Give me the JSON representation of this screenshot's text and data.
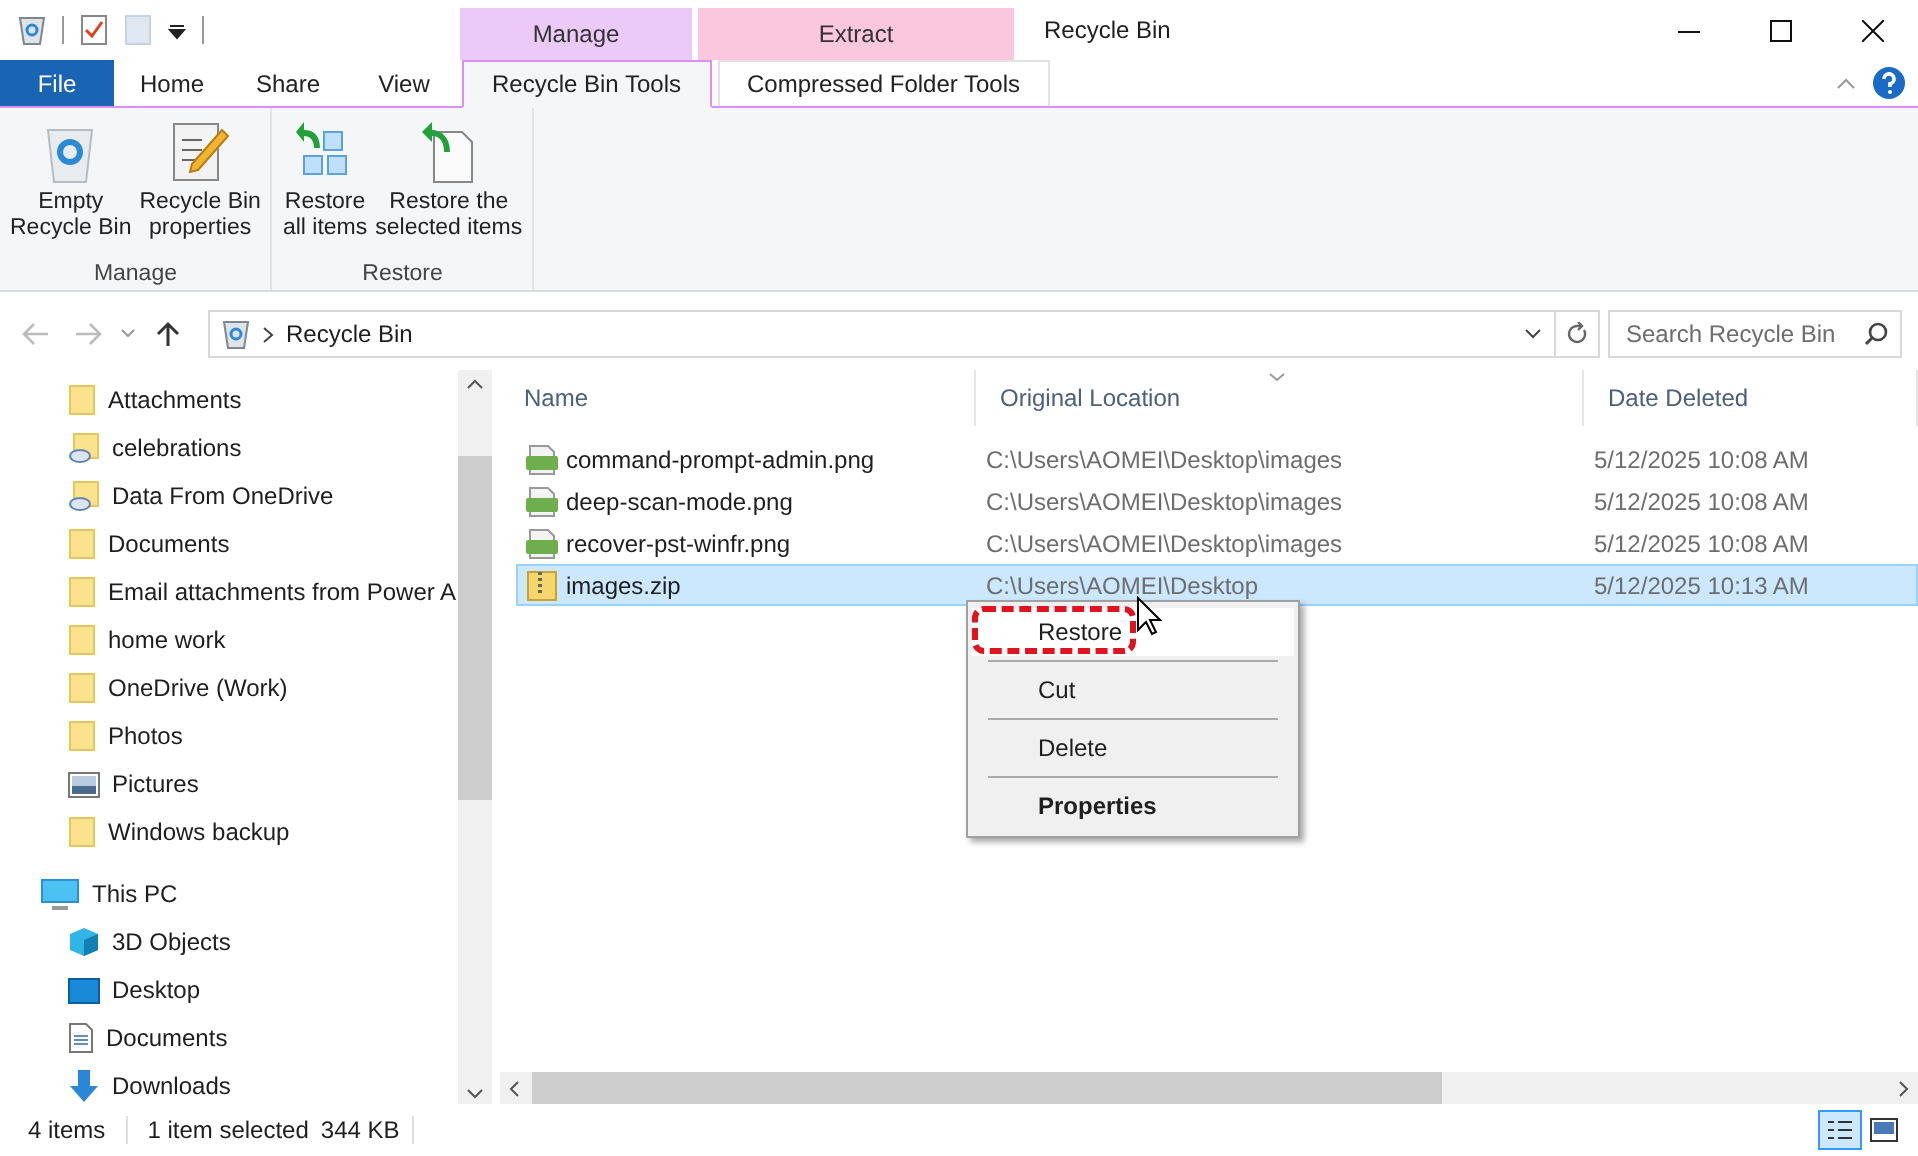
{
  "window": {
    "title": "Recycle Bin"
  },
  "ribbon": {
    "tabs": [
      {
        "label": "File",
        "kind": "file",
        "selected": false
      },
      {
        "label": "Home",
        "kind": "normal",
        "selected": false
      },
      {
        "label": "Share",
        "kind": "normal",
        "selected": false
      },
      {
        "label": "View",
        "kind": "normal",
        "selected": false
      },
      {
        "label": "Recycle Bin Tools",
        "kind": "context",
        "context_label": "Manage",
        "color": "#ebcaf8",
        "selected": true
      },
      {
        "label": "Compressed Folder Tools",
        "kind": "context",
        "context_label": "Extract",
        "color": "#fbc7dc",
        "selected": false
      }
    ],
    "groups": [
      {
        "label": "Manage",
        "buttons": [
          {
            "label": "Empty\nRecycle Bin",
            "kind": "bin"
          },
          {
            "label": "Recycle Bin\nproperties",
            "kind": "props"
          }
        ]
      },
      {
        "label": "Restore",
        "buttons": [
          {
            "label": "Restore\nall items",
            "kind": "restore_all"
          },
          {
            "label": "Restore the\nselected items",
            "kind": "restore_sel"
          }
        ]
      }
    ]
  },
  "address": {
    "path": "Recycle Bin",
    "search_placeholder": "Search Recycle Bin"
  },
  "nav": [
    {
      "items": [
        {
          "label": "Attachments",
          "kind": "folder"
        },
        {
          "label": "celebrations",
          "kind": "link"
        },
        {
          "label": "Data From OneDrive",
          "kind": "link"
        },
        {
          "label": "Documents",
          "kind": "folder"
        },
        {
          "label": "Email attachments from Power A",
          "kind": "folder"
        },
        {
          "label": "home work",
          "kind": "folder"
        },
        {
          "label": "OneDrive (Work)",
          "kind": "folder"
        },
        {
          "label": "Photos",
          "kind": "folder"
        },
        {
          "label": "Pictures",
          "kind": "pictures"
        },
        {
          "label": "Windows backup",
          "kind": "folder"
        }
      ]
    },
    {
      "label": "This PC",
      "kind": "pc",
      "items": [
        {
          "label": "3D Objects",
          "kind": "cube"
        },
        {
          "label": "Desktop",
          "kind": "desktop"
        },
        {
          "label": "Documents",
          "kind": "doc"
        },
        {
          "label": "Downloads",
          "kind": "download"
        }
      ]
    }
  ],
  "files": {
    "columns": [
      "Name",
      "Original Location",
      "Date Deleted"
    ],
    "rows": [
      {
        "name": "command-prompt-admin.png",
        "kind": "png",
        "location": "C:\\Users\\AOMEI\\Desktop\\images",
        "date": "5/12/2025 10:08 AM",
        "selected": false
      },
      {
        "name": "deep-scan-mode.png",
        "kind": "png",
        "location": "C:\\Users\\AOMEI\\Desktop\\images",
        "date": "5/12/2025 10:08 AM",
        "selected": false
      },
      {
        "name": "recover-pst-winfr.png",
        "kind": "png",
        "location": "C:\\Users\\AOMEI\\Desktop\\images",
        "date": "5/12/2025 10:08 AM",
        "selected": false
      },
      {
        "name": "images.zip",
        "kind": "zip",
        "location": "C:\\Users\\AOMEI\\Desktop",
        "date": "5/12/2025 10:13 AM",
        "selected": true
      }
    ]
  },
  "context_menu": {
    "items": [
      {
        "label": "Restore",
        "bold": false,
        "highlighted": true
      },
      {
        "label": "Cut",
        "bold": false,
        "highlighted": false
      },
      {
        "label": "Delete",
        "bold": false,
        "highlighted": false
      },
      {
        "label": "Properties",
        "bold": true,
        "highlighted": false
      }
    ]
  },
  "status_bar": {
    "texts": [
      "4 items",
      "1 item selected",
      "344 KB"
    ],
    "views": [
      {
        "kind": "details",
        "selected": true
      },
      {
        "kind": "large_icons",
        "selected": false
      }
    ]
  }
}
